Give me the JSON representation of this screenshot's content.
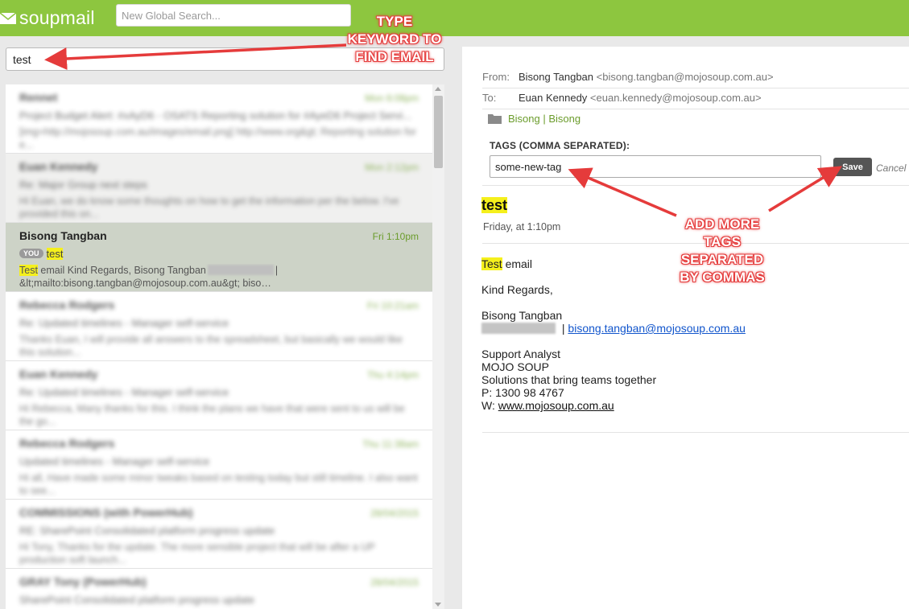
{
  "app": {
    "logo_text": "soupmail",
    "global_search_placeholder": "New Global Search..."
  },
  "search": {
    "value": "test"
  },
  "mail_list": [
    {
      "sender": "Rennet",
      "date": "Mon 6:08pm",
      "subject": "Project Budget Alert: #xAyD6 - OSATS Reporting solution for #AyeD6 Project Servi...",
      "preview": "[img=http://mojosoup.com.au/images/email.png] http://www.org&gt; Reporting solution for e...",
      "blurred": true,
      "style": "normal"
    },
    {
      "sender": "Euan Kennedy",
      "date": "Mon 2:12pm",
      "subject": "Re: Major Group next steps",
      "preview": "Hi Euan, we do know some thoughts on how to get the information per the below. I've provided this on...",
      "blurred": true,
      "style": "grey"
    },
    {
      "sender": "Bisong Tangban",
      "date": "Fri 1:10pm",
      "you_badge": "YOU",
      "subject_hl": "test",
      "preview_hl": "Test",
      "preview_rest1": " email Kind Regards, Bisong Tangban",
      "preview_sep": "|",
      "preview_rest2": "&lt;mailto:bisong.tangban@mojosoup.com.au&gt; biso…",
      "blurred": false,
      "style": "selected"
    },
    {
      "sender": "Rebecca Rodgers",
      "date": "Fri 10:21am",
      "subject": "Re: Updated timelines - Manager self-service",
      "preview": "Thanks Euan, I will provide all answers to the spreadsheet, but basically we would like this solution...",
      "blurred": true,
      "style": "normal"
    },
    {
      "sender": "Euan Kennedy",
      "date": "Thu 4:14pm",
      "subject": "Re: Updated timelines - Manager self-service",
      "preview": "Hi Rebecca, Many thanks for this. I think the plans we have that were sent to us will be the go...",
      "blurred": true,
      "style": "normal"
    },
    {
      "sender": "Rebecca Rodgers",
      "date": "Thu 11:38am",
      "subject": "Updated timelines - Manager self-service",
      "preview": "Hi all, Have made some minor tweaks based on testing today but still timeline. I also want to see...",
      "blurred": true,
      "style": "normal"
    },
    {
      "sender": "COMMISSIONS (with PowerHub)",
      "date": "28/04/2015",
      "subject": "RE: SharePoint Consolidated platform progress update",
      "preview": "Hi Tony, Thanks for the update. The more sensible project that will be after a UP production soft launch...",
      "blurred": true,
      "style": "normal"
    },
    {
      "sender": "GRAY Tony (PowerHub)",
      "date": "28/04/2015",
      "subject": "SharePoint Consolidated platform progress update",
      "preview": "",
      "blurred": true,
      "style": "normal"
    }
  ],
  "message": {
    "from_label": "From:",
    "from_name": "Bisong Tangban",
    "from_email": "<bisong.tangban@mojosoup.com.au>",
    "to_label": "To:",
    "to_name": "Euan Kennedy",
    "to_email": "<euan.kennedy@mojosoup.com.au>",
    "folder": "Bisong | Bisong",
    "tags_label": "TAGS (COMMA SEPARATED):",
    "tags_value": "some-new-tag",
    "save_label": "Save",
    "cancel_label": "Cancel",
    "subject": "test",
    "date": "Friday, at 1:10pm",
    "body": {
      "line1_hl": "Test",
      "line1_rest": " email",
      "regards": "Kind Regards,",
      "name": "Bisong Tangban",
      "separator": " | ",
      "email_link": "bisong.tangban@mojosoup.com.au",
      "title": "Support Analyst",
      "company": "MOJO SOUP",
      "tagline": "Solutions that bring teams together",
      "phone": "P:   1300 98 4767",
      "web_label": "W:  ",
      "web_link": "www.mojosoup.com.au"
    }
  },
  "annotations": {
    "keyword": [
      "TYPE",
      "KEYWORD TO",
      "FIND EMAIL"
    ],
    "tags": [
      "ADD MORE",
      "TAGS",
      "SEPARATED",
      "BY COMMAS"
    ]
  },
  "colors": {
    "brand_green": "#8dc63f",
    "date_green": "#6b9c2c",
    "selected_row": "#cdd3c7",
    "highlight": "#f5f01c",
    "annotation_red": "#e53b3b"
  }
}
